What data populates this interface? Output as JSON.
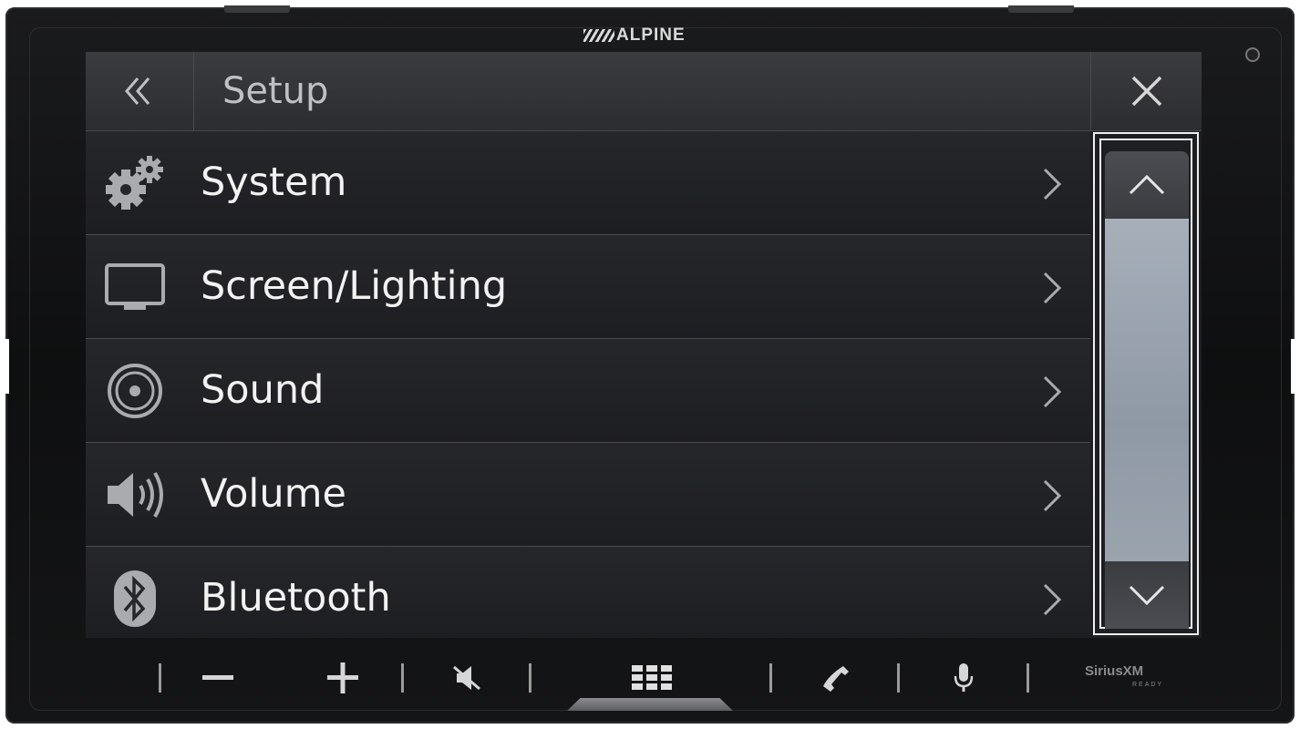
{
  "device": {
    "brand": "ALPINE",
    "sirius": {
      "label": "SiriusXM",
      "sub": "READY"
    }
  },
  "header": {
    "title": "Setup",
    "back_icon": "double-chevron-left-icon",
    "close_icon": "close-icon"
  },
  "menu": {
    "items": [
      {
        "label": "System",
        "icon": "gears-icon"
      },
      {
        "label": "Screen/Lighting",
        "icon": "monitor-icon"
      },
      {
        "label": "Sound",
        "icon": "speaker-icon"
      },
      {
        "label": "Volume",
        "icon": "volume-icon"
      },
      {
        "label": "Bluetooth",
        "icon": "bluetooth-icon"
      }
    ]
  },
  "scrollbar": {
    "position": 0,
    "up_icon": "chevron-up-icon",
    "down_icon": "chevron-down-icon"
  },
  "hardware_buttons": [
    {
      "name": "volume-down",
      "symbol": "−",
      "icon": "minus-icon"
    },
    {
      "name": "volume-up",
      "symbol": "+",
      "icon": "plus-icon"
    },
    {
      "name": "mute",
      "icon": "mute-icon"
    },
    {
      "name": "home",
      "icon": "grid-menu-icon"
    },
    {
      "name": "phone",
      "icon": "phone-icon"
    },
    {
      "name": "voice",
      "icon": "microphone-icon"
    }
  ],
  "colors": {
    "screen_bg": "#1e1f22",
    "text": "#f2f2f2",
    "highlight_frame": "#f0f0f0",
    "scroll_track": "#9ba3ad"
  }
}
